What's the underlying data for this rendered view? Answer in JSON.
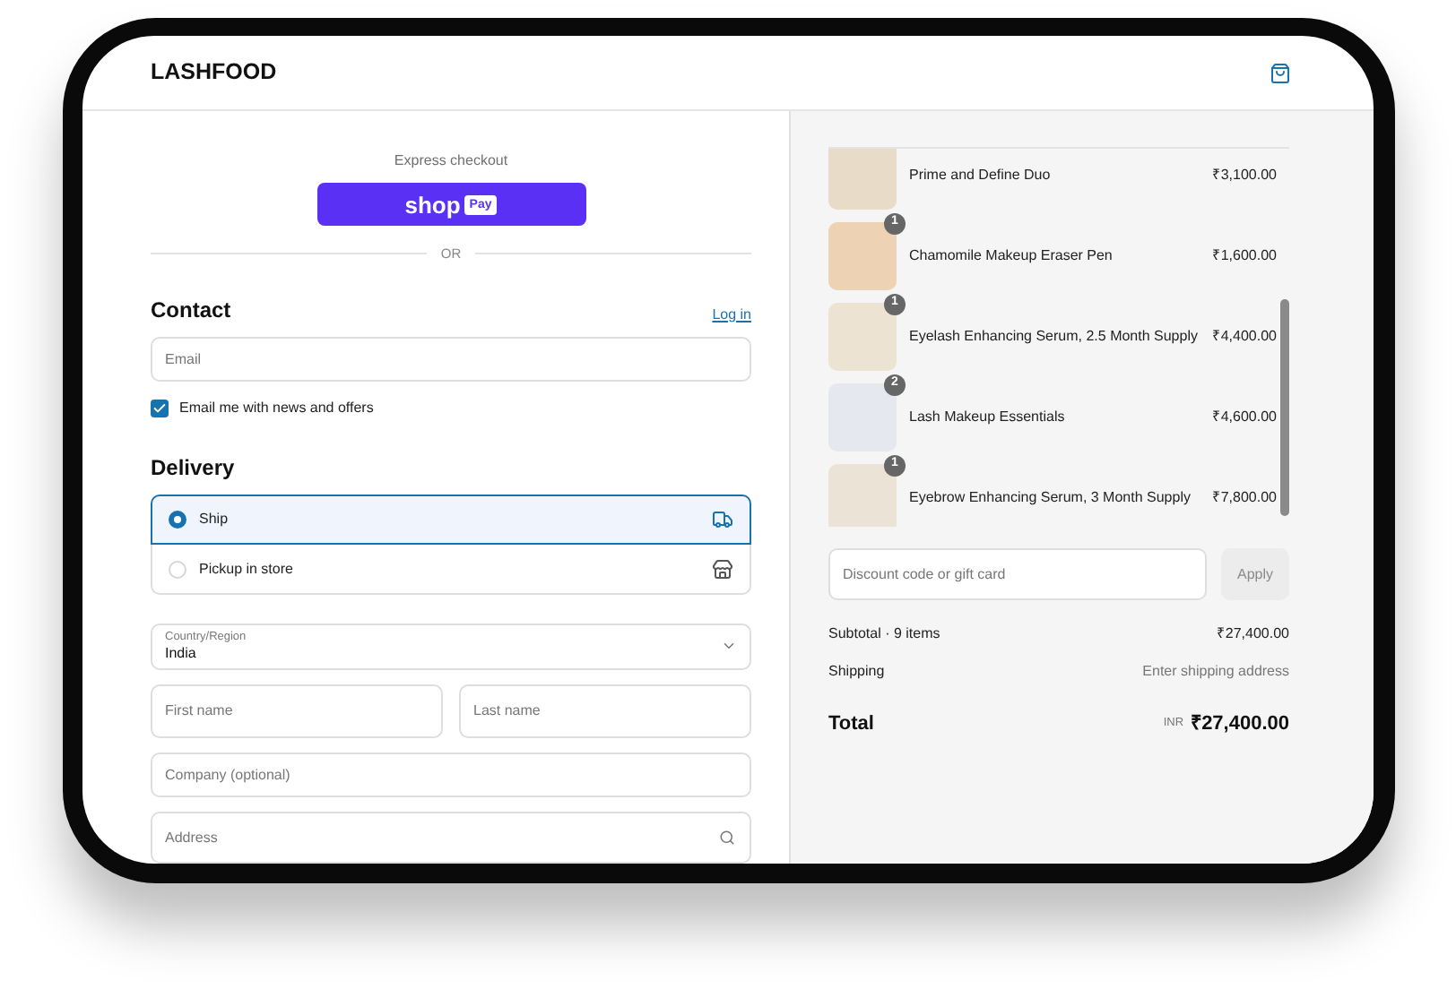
{
  "header": {
    "brand": "LASHFOOD"
  },
  "express": {
    "label": "Express checkout",
    "shop_pay": {
      "word": "shop",
      "badge": "Pay"
    },
    "divider": "OR"
  },
  "contact": {
    "title": "Contact",
    "login_link": "Log in",
    "email": {
      "placeholder": "Email"
    },
    "newsletter": {
      "label": "Email me with news and offers",
      "checked": true
    }
  },
  "delivery": {
    "title": "Delivery",
    "options": [
      {
        "label": "Ship",
        "selected": true,
        "kind": "ship"
      },
      {
        "label": "Pickup in store",
        "selected": false,
        "kind": "store"
      }
    ],
    "country": {
      "label": "Country/Region",
      "value": "India"
    },
    "first_name": {
      "placeholder": "First name"
    },
    "last_name": {
      "placeholder": "Last name"
    },
    "company": {
      "placeholder": "Company (optional)"
    },
    "address": {
      "placeholder": "Address"
    }
  },
  "order": {
    "items": [
      {
        "name": "Prime and Define Duo",
        "price": "₹3,100.00"
      },
      {
        "name": "Chamomile Makeup Eraser Pen",
        "quantity": "1",
        "price": "₹1,600.00"
      },
      {
        "name": "Eyelash Enhancing Serum, 2.5 Month Supply",
        "quantity": "1",
        "price": "₹4,400.00"
      },
      {
        "name": "Lash Makeup Essentials",
        "quantity": "2",
        "price": "₹4,600.00"
      },
      {
        "name": "Eyebrow Enhancing Serum, 3 Month Supply",
        "quantity": "1",
        "price": "₹7,800.00"
      }
    ],
    "discount": {
      "placeholder": "Discount code or gift card",
      "button": "Apply"
    },
    "subtotal": {
      "label": "Subtotal · 9 items",
      "value": "₹27,400.00"
    },
    "shipping": {
      "label": "Shipping",
      "value": "Enter shipping address"
    },
    "total": {
      "label": "Total",
      "currency": "INR",
      "value": "₹27,400.00"
    }
  }
}
